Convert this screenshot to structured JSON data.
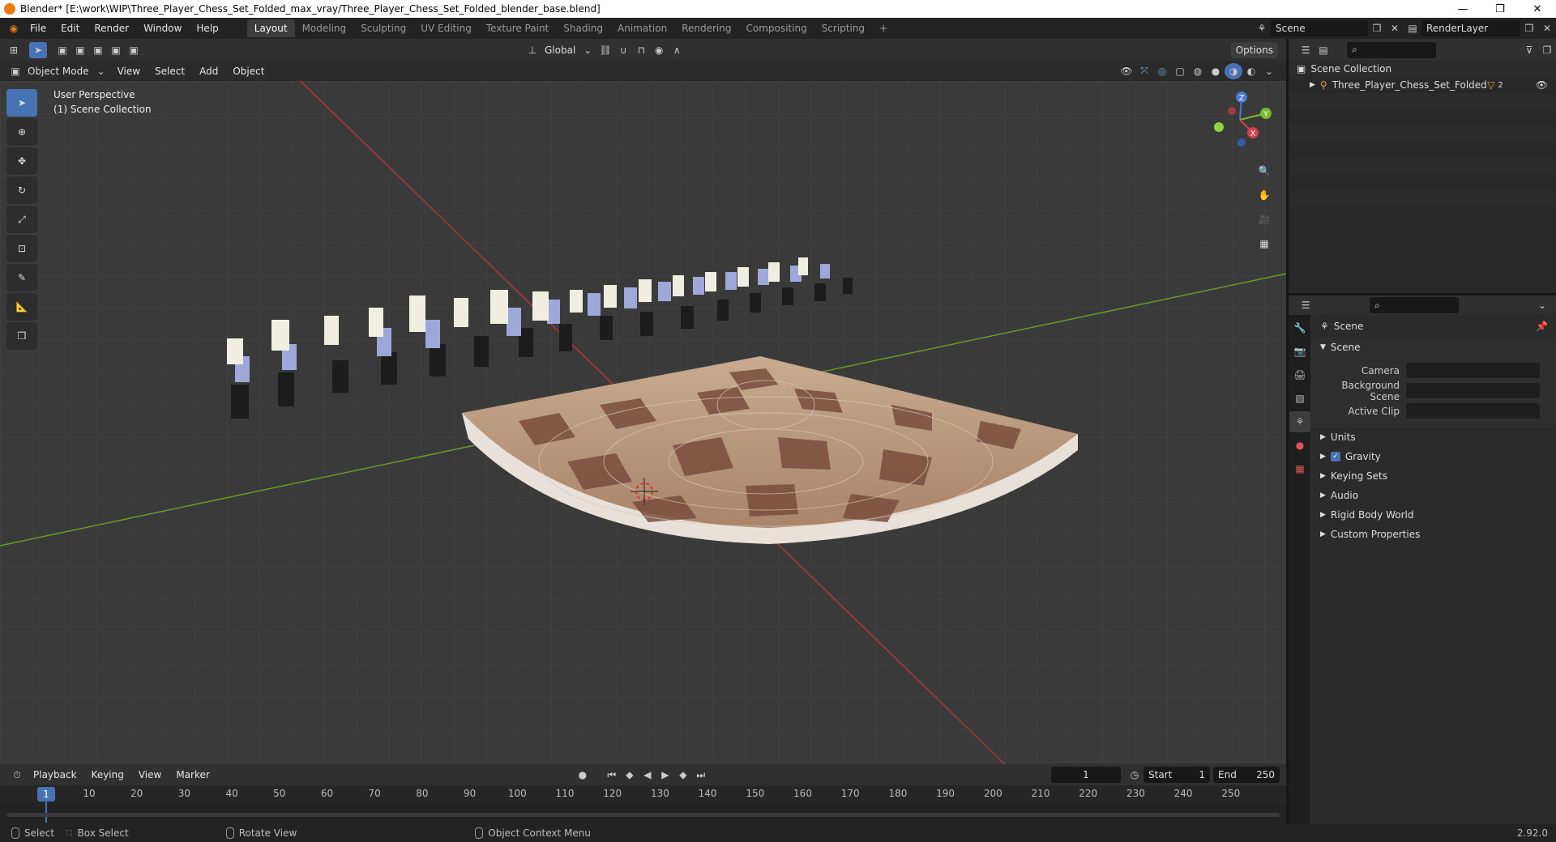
{
  "window": {
    "title": "Blender* [E:\\work\\WIP\\Three_Player_Chess_Set_Folded_max_vray/Three_Player_Chess_Set_Folded_blender_base.blend]",
    "minimize": "—",
    "restore": "❐",
    "close": "✕"
  },
  "menu": [
    "File",
    "Edit",
    "Render",
    "Window",
    "Help"
  ],
  "workspaces": [
    "Layout",
    "Modeling",
    "Sculpting",
    "UV Editing",
    "Texture Paint",
    "Shading",
    "Animation",
    "Rendering",
    "Compositing",
    "Scripting"
  ],
  "active_workspace": "Layout",
  "add_workspace": "+",
  "scene_selector": "Scene",
  "render_layer": "RenderLayer",
  "viewport": {
    "mode": "Object Mode",
    "menus": [
      "View",
      "Select",
      "Add",
      "Object"
    ],
    "orientation": "Global",
    "options": "Options",
    "perspective": "User Perspective",
    "collection": "(1) Scene Collection",
    "gizmo": {
      "x": "X",
      "y": "Y",
      "z": "Z"
    }
  },
  "outliner": {
    "scene_collection": "Scene Collection",
    "object": "Three_Player_Chess_Set_Folded",
    "badge": "2"
  },
  "properties": {
    "context": "Scene",
    "panel": "Scene",
    "fields": [
      {
        "label": "Camera",
        "value": ""
      },
      {
        "label": "Background Scene",
        "value": ""
      },
      {
        "label": "Active Clip",
        "value": ""
      }
    ],
    "sections": [
      "Units",
      "Gravity",
      "Keying Sets",
      "Audio",
      "Rigid Body World",
      "Custom Properties"
    ],
    "gravity_checked": true
  },
  "timeline": {
    "menus": [
      "Playback",
      "Keying",
      "View",
      "Marker"
    ],
    "current_frame": "1",
    "start_label": "Start",
    "start": "1",
    "end_label": "End",
    "end": "250",
    "ticks": [
      "1",
      "10",
      "20",
      "30",
      "40",
      "50",
      "60",
      "70",
      "80",
      "90",
      "100",
      "110",
      "120",
      "130",
      "140",
      "150",
      "160",
      "170",
      "180",
      "190",
      "200",
      "210",
      "220",
      "230",
      "240",
      "250"
    ]
  },
  "statusbar": {
    "select": "Select",
    "box_select": "Box Select",
    "rotate_view": "Rotate View",
    "context_menu": "Object Context Menu",
    "version": "2.92.0"
  },
  "colors": {
    "accent": "#4772b3",
    "board_light": "#b89a80",
    "board_dark": "#7a4d3e"
  }
}
